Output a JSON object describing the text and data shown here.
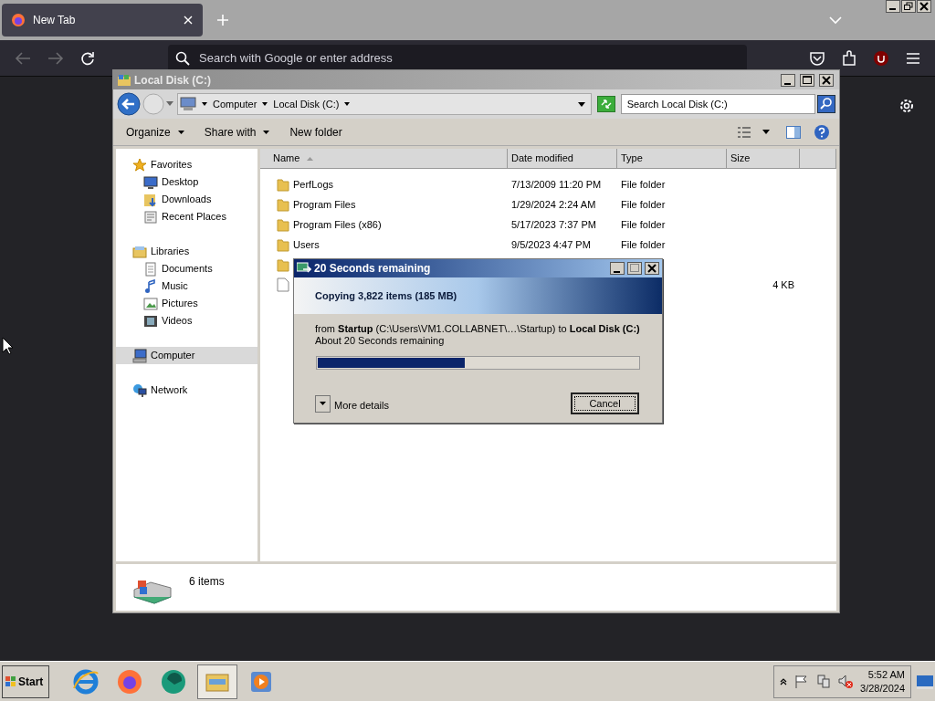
{
  "browser": {
    "tabs": [
      {
        "label": "New Tab",
        "selected": true
      }
    ],
    "address": {
      "placeholder": "Search with Google or enter address"
    }
  },
  "explorer": {
    "title": "Local Disk (C:)",
    "breadcrumb": [
      "Computer",
      "Local Disk (C:)"
    ],
    "search": {
      "placeholder": "Search Local Disk (C:)"
    },
    "commands": [
      "Organize",
      "Share with",
      "New folder"
    ],
    "sidebar": [
      {
        "label": "Favorites",
        "kind": "star",
        "selected": false,
        "children": [
          {
            "label": "Desktop",
            "kind": "desktop",
            "selected": false
          },
          {
            "label": "Downloads",
            "kind": "downloads",
            "selected": false
          },
          {
            "label": "Recent Places",
            "kind": "recent",
            "selected": false
          }
        ]
      },
      {
        "label": "Libraries",
        "kind": "library",
        "selected": false,
        "children": [
          {
            "label": "Documents",
            "kind": "document",
            "selected": false
          },
          {
            "label": "Music",
            "kind": "music",
            "selected": false
          },
          {
            "label": "Pictures",
            "kind": "picture",
            "selected": false
          },
          {
            "label": "Videos",
            "kind": "video",
            "selected": false
          }
        ]
      },
      {
        "label": "Computer",
        "kind": "computer",
        "selected": true
      },
      {
        "label": "Network",
        "kind": "network",
        "selected": false
      }
    ],
    "columns": [
      "Name",
      "Date modified",
      "Type",
      "Size"
    ],
    "rows": [
      {
        "kind": "folder",
        "name": "PerfLogs",
        "date": "7/13/2009 11:20 PM",
        "type": "File folder"
      },
      {
        "kind": "folder",
        "name": "Program Files",
        "date": "1/29/2024 2:24 AM",
        "type": "File folder"
      },
      {
        "kind": "folder",
        "name": "Program Files (x86)",
        "date": "5/17/2023 7:37 PM",
        "type": "File folder"
      },
      {
        "kind": "folder",
        "name": "Users",
        "date": "9/5/2023 4:47 PM",
        "type": "File folder"
      },
      {
        "kind": "folder"
      },
      {
        "kind": "file",
        "size": "4 KB"
      }
    ],
    "status": "6 items"
  },
  "dialog": {
    "title": "20 Seconds remaining",
    "heading": "Copying 3,822 items (185 MB)",
    "from": "from **Startup** (C:\\Users\\VM1.COLLABNET\\…\\Startup)  to **Local Disk (C:)**",
    "remaining": "About 20 Seconds remaining",
    "level": 0.46,
    "details": "More details",
    "cancel": "Cancel"
  },
  "taskbar": {
    "start": "Start",
    "apps": [
      {
        "kind": "ie",
        "selected": false
      },
      {
        "kind": "firefox",
        "selected": false
      },
      {
        "kind": "green",
        "selected": false
      },
      {
        "kind": "explorer",
        "selected": true
      },
      {
        "kind": "media",
        "selected": false
      }
    ],
    "time": "5:52 AM",
    "date": "3/28/2024"
  }
}
